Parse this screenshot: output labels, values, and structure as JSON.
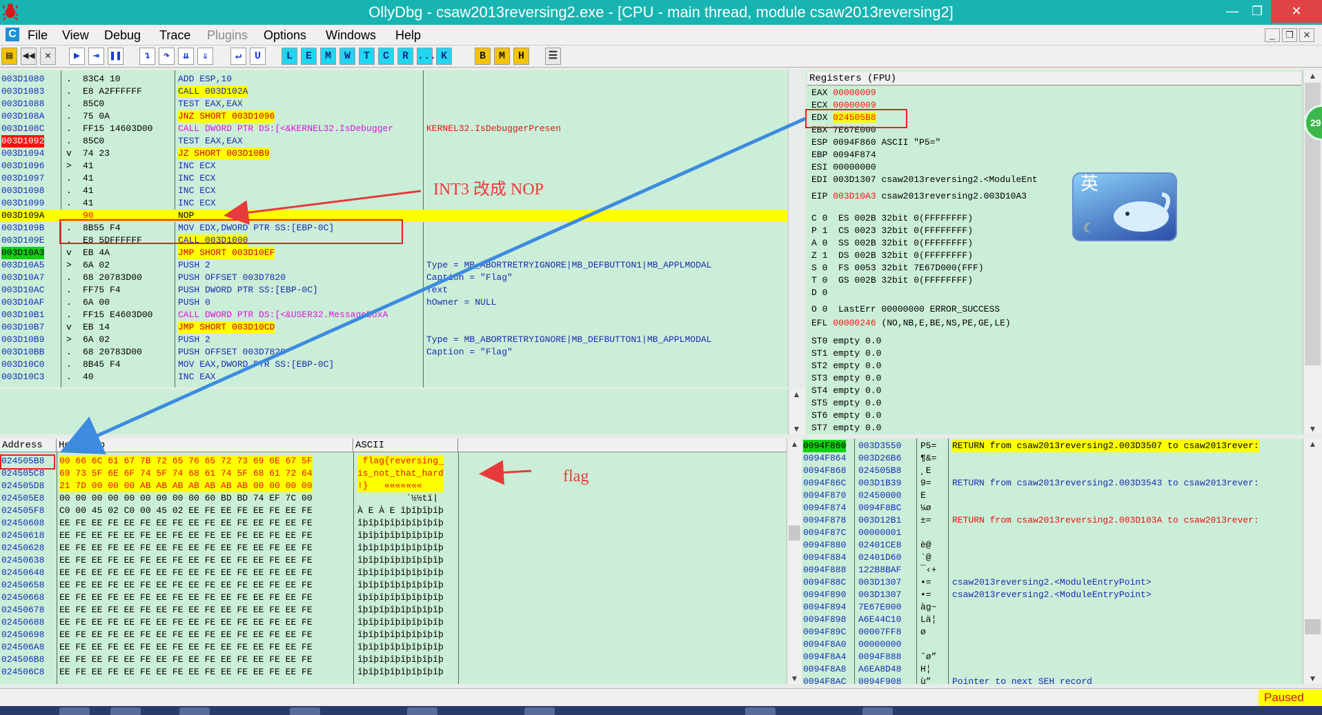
{
  "window": {
    "title": "OllyDbg - csaw2013reversing2.exe - [CPU - main thread, module csaw2013reversing2]"
  },
  "menu": {
    "app_letter": "C",
    "items": [
      "File",
      "View",
      "Debug",
      "Trace",
      "Plugins",
      "Options",
      "Windows",
      "Help"
    ],
    "disabled": [
      "Plugins"
    ]
  },
  "toolbar": {
    "letters": [
      "L",
      "E",
      "M",
      "W",
      "T",
      "C",
      "R",
      "...",
      "K",
      "B",
      "M",
      "H"
    ]
  },
  "disasm": {
    "rows": [
      {
        "addr": "003D1080",
        "mark": ".",
        "hex": "83C4 10",
        "asm": "ADD ESP,10",
        "comment": ""
      },
      {
        "addr": "003D1083",
        "mark": ".",
        "hex": "E8 A2FFFFFF",
        "asm": "CALL 003D102A",
        "comment": ""
      },
      {
        "addr": "003D1088",
        "mark": ".",
        "hex": "85C0",
        "asm": "TEST EAX,EAX",
        "comment": ""
      },
      {
        "addr": "003D108A",
        "mark": ".",
        "hex": "75 0A",
        "asm": "JNZ SHORT 003D1096",
        "comment": ""
      },
      {
        "addr": "003D108C",
        "mark": ".",
        "hex": "FF15 14603D00",
        "asm": "CALL DWORD PTR DS:[<&KERNEL32.IsDebugger",
        "comment": "KERNEL32.IsDebuggerPresen"
      },
      {
        "addr": "003D1092",
        "mark": ".",
        "hex": "85C0",
        "asm": "TEST EAX,EAX",
        "comment": ""
      },
      {
        "addr": "003D1094",
        "mark": "v",
        "hex": "74 23",
        "asm": "JZ SHORT 003D10B9",
        "comment": ""
      },
      {
        "addr": "003D1096",
        "mark": ">",
        "hex": "41",
        "asm": "INC ECX",
        "comment": ""
      },
      {
        "addr": "003D1097",
        "mark": ".",
        "hex": "41",
        "asm": "INC ECX",
        "comment": ""
      },
      {
        "addr": "003D1098",
        "mark": ".",
        "hex": "41",
        "asm": "INC ECX",
        "comment": ""
      },
      {
        "addr": "003D1099",
        "mark": ".",
        "hex": "41",
        "asm": "INC ECX",
        "comment": ""
      },
      {
        "addr": "003D109A",
        "mark": "",
        "hex": "90",
        "asm": "NOP",
        "comment": ""
      },
      {
        "addr": "003D109B",
        "mark": ".",
        "hex": "8B55 F4",
        "asm": "MOV EDX,DWORD PTR SS:[EBP-0C]",
        "comment": ""
      },
      {
        "addr": "003D109E",
        "mark": ".",
        "hex": "E8 5DFFFFFF",
        "asm": "CALL 003D1000",
        "comment": ""
      },
      {
        "addr": "003D10A3",
        "mark": "v",
        "hex": "EB 4A",
        "asm": "JMP SHORT 003D10EF",
        "comment": ""
      },
      {
        "addr": "003D10A5",
        "mark": ">",
        "hex": "6A 02",
        "asm": "PUSH 2",
        "comment": "Type = MB_ABORTRETRYIGNORE|MB_DEFBUTTON1|MB_APPLMODAL"
      },
      {
        "addr": "003D10A7",
        "mark": ".",
        "hex": "68 20783D00",
        "asm": "PUSH OFFSET 003D7820",
        "comment": "Caption = \"Flag\""
      },
      {
        "addr": "003D10AC",
        "mark": ".",
        "hex": "FF75 F4",
        "asm": "PUSH DWORD PTR SS:[EBP-0C]",
        "comment": "Text"
      },
      {
        "addr": "003D10AF",
        "mark": ".",
        "hex": "6A 00",
        "asm": "PUSH 0",
        "comment": "hOwner = NULL"
      },
      {
        "addr": "003D10B1",
        "mark": ".",
        "hex": "FF15 E4603D00",
        "asm": "CALL DWORD PTR DS:[<&USER32.MessageBoxA",
        "comment": ""
      },
      {
        "addr": "003D10B7",
        "mark": "v",
        "hex": "EB 14",
        "asm": "JMP SHORT 003D10CD",
        "comment": ""
      },
      {
        "addr": "003D10B9",
        "mark": ">",
        "hex": "6A 02",
        "asm": "PUSH 2",
        "comment": "Type = MB_ABORTRETRYIGNORE|MB_DEFBUTTON1|MB_APPLMODAL"
      },
      {
        "addr": "003D10BB",
        "mark": ".",
        "hex": "68 20783D00",
        "asm": "PUSH OFFSET 003D7820",
        "comment": "Caption = \"Flag\""
      },
      {
        "addr": "003D10C0",
        "mark": ".",
        "hex": "8B45 F4",
        "asm": "MOV EAX,DWORD PTR SS:[EBP-0C]",
        "comment": ""
      },
      {
        "addr": "003D10C3",
        "mark": ".",
        "hex": "40",
        "asm": "INC EAX",
        "comment": ""
      }
    ]
  },
  "registers": {
    "header": "Registers (FPU)",
    "lines": [
      {
        "name": "EAX",
        "val": "00000009",
        "extra": ""
      },
      {
        "name": "ECX",
        "val": "00000009",
        "extra": ""
      },
      {
        "name": "EDX",
        "val": "024505B8",
        "extra": ""
      },
      {
        "name": "EBX",
        "val": "7E67E000",
        "extra": ""
      },
      {
        "name": "ESP",
        "val": "0094F860",
        "extra": "ASCII \"P5=\""
      },
      {
        "name": "EBP",
        "val": "0094F874",
        "extra": ""
      },
      {
        "name": "ESI",
        "val": "00000000",
        "extra": ""
      },
      {
        "name": "EDI",
        "val": "003D1307",
        "extra": "csaw2013reversing2.<ModuleEnt"
      },
      {
        "name": "EIP",
        "val": "003D10A3",
        "extra": "csaw2013reversing2.003D10A3"
      }
    ],
    "flags": [
      "C 0  ES 002B 32bit 0(FFFFFFFF)",
      "P 1  CS 0023 32bit 0(FFFFFFFF)",
      "A 0  SS 002B 32bit 0(FFFFFFFF)",
      "Z 1  DS 002B 32bit 0(FFFFFFFF)",
      "S 0  FS 0053 32bit 7E67D000(FFF)",
      "T 0  GS 002B 32bit 0(FFFFFFFF)",
      "D 0",
      "O 0  LastErr 00000000 ERROR_SUCCESS"
    ],
    "efl": "EFL",
    "efl_val": "00000246",
    "efl_flags": "(NO,NB,E,BE,NS,PE,GE,LE)",
    "fpu": [
      "ST0 empty 0.0",
      "ST1 empty 0.0",
      "ST2 empty 0.0",
      "ST3 empty 0.0",
      "ST4 empty 0.0",
      "ST5 empty 0.0",
      "ST6 empty 0.0",
      "ST7 empty 0.0"
    ],
    "ime_char": "英",
    "side_badge": "29"
  },
  "dump": {
    "headers": {
      "address": "Address",
      "hex": "Hex dump",
      "ascii": "ASCII"
    },
    "rows": [
      {
        "addr": "024505B8",
        "hex": "00 66 6C 61 67 7B 72 65 76 65 72 73 69 6E 67 5F",
        "ascii": " flag{reversing_"
      },
      {
        "addr": "024505C8",
        "hex": "69 73 5F 6E 6F 74 5F 74 68 61 74 5F 68 61 72 64",
        "ascii": "is_not_that_hard"
      },
      {
        "addr": "024505D8",
        "hex": "21 7D 00 00 00 AB AB AB AB AB AB AB 00 00 00 00",
        "ascii": "!}   «««««««    "
      },
      {
        "addr": "024505E8",
        "hex": "00 00 00 00 00 00 00 00 00 60 BD BD 74 EF 7C 00",
        "ascii": "         `½½tï| "
      },
      {
        "addr": "024505F8",
        "hex": "C0 00 45 02 C0 00 45 02 EE FE EE FE EE FE EE FE",
        "ascii": "À E À E îþîþîþîþ"
      },
      {
        "addr": "02450608",
        "hex": "EE FE EE FE EE FE EE FE EE FE EE FE EE FE EE FE",
        "ascii": "îþîþîþîþîþîþîþîþ"
      },
      {
        "addr": "02450618",
        "hex": "EE FE EE FE EE FE EE FE EE FE EE FE EE FE EE FE",
        "ascii": "îþîþîþîþîþîþîþîþ"
      },
      {
        "addr": "02450628",
        "hex": "EE FE EE FE EE FE EE FE EE FE EE FE EE FE EE FE",
        "ascii": "îþîþîþîþîþîþîþîþ"
      },
      {
        "addr": "02450638",
        "hex": "EE FE EE FE EE FE EE FE EE FE EE FE EE FE EE FE",
        "ascii": "îþîþîþîþîþîþîþîþ"
      },
      {
        "addr": "02450648",
        "hex": "EE FE EE FE EE FE EE FE EE FE EE FE EE FE EE FE",
        "ascii": "îþîþîþîþîþîþîþîþ"
      },
      {
        "addr": "02450658",
        "hex": "EE FE EE FE EE FE EE FE EE FE EE FE EE FE EE FE",
        "ascii": "îþîþîþîþîþîþîþîþ"
      },
      {
        "addr": "02450668",
        "hex": "EE FE EE FE EE FE EE FE EE FE EE FE EE FE EE FE",
        "ascii": "îþîþîþîþîþîþîþîþ"
      },
      {
        "addr": "02450678",
        "hex": "EE FE EE FE EE FE EE FE EE FE EE FE EE FE EE FE",
        "ascii": "îþîþîþîþîþîþîþîþ"
      },
      {
        "addr": "02450688",
        "hex": "EE FE EE FE EE FE EE FE EE FE EE FE EE FE EE FE",
        "ascii": "îþîþîþîþîþîþîþîþ"
      },
      {
        "addr": "02450698",
        "hex": "EE FE EE FE EE FE EE FE EE FE EE FE EE FE EE FE",
        "ascii": "îþîþîþîþîþîþîþîþ"
      },
      {
        "addr": "024506A8",
        "hex": "EE FE EE FE EE FE EE FE EE FE EE FE EE FE EE FE",
        "ascii": "îþîþîþîþîþîþîþîþ"
      },
      {
        "addr": "024506B8",
        "hex": "EE FE EE FE EE FE EE FE EE FE EE FE EE FE EE FE",
        "ascii": "îþîþîþîþîþîþîþîþ"
      },
      {
        "addr": "024506C8",
        "hex": "EE FE EE FE EE FE EE FE EE FE EE FE EE FE EE FE",
        "ascii": "îþîþîþîþîþîþîþîþ"
      }
    ]
  },
  "stack": {
    "rows": [
      {
        "addr": "0094F860",
        "val": "003D3550",
        "asc": "P5=",
        "comment": "RETURN from csaw2013reversing2.003D3507 to csaw2013rever:"
      },
      {
        "addr": "0094F864",
        "val": "003D26B6",
        "asc": "¶&=",
        "comment": ""
      },
      {
        "addr": "0094F868",
        "val": "024505B8",
        "asc": "¸E",
        "comment": ""
      },
      {
        "addr": "0094F86C",
        "val": "003D1B39",
        "asc": "9=",
        "comment": "RETURN from csaw2013reversing2.003D3543 to csaw2013rever:"
      },
      {
        "addr": "0094F870",
        "val": "02450000",
        "asc": "E",
        "comment": ""
      },
      {
        "addr": "0094F874",
        "val": "0094F8BC",
        "asc": "¼ø",
        "comment": ""
      },
      {
        "addr": "0094F878",
        "val": "003D12B1",
        "asc": "±=",
        "comment": "RETURN from csaw2013reversing2.003D103A to csaw2013rever:"
      },
      {
        "addr": "0094F87C",
        "val": "00000001",
        "asc": "",
        "comment": ""
      },
      {
        "addr": "0094F880",
        "val": "02401CE8",
        "asc": "è@",
        "comment": ""
      },
      {
        "addr": "0094F884",
        "val": "02401D60",
        "asc": "`@",
        "comment": ""
      },
      {
        "addr": "0094F888",
        "val": "122B8BAF",
        "asc": "¯‹+",
        "comment": ""
      },
      {
        "addr": "0094F88C",
        "val": "003D1307",
        "asc": "•=",
        "comment": "csaw2013reversing2.<ModuleEntryPoint>"
      },
      {
        "addr": "0094F890",
        "val": "003D1307",
        "asc": "•=",
        "comment": "csaw2013reversing2.<ModuleEntryPoint>"
      },
      {
        "addr": "0094F894",
        "val": "7E67E000",
        "asc": "àg~",
        "comment": ""
      },
      {
        "addr": "0094F898",
        "val": "A6E44C10",
        "asc": "Lä¦",
        "comment": ""
      },
      {
        "addr": "0094F89C",
        "val": "00007FF8",
        "asc": "ø",
        "comment": ""
      },
      {
        "addr": "0094F8A0",
        "val": "00000000",
        "asc": "",
        "comment": ""
      },
      {
        "addr": "0094F8A4",
        "val": "0094F888",
        "asc": "ˆø”",
        "comment": ""
      },
      {
        "addr": "0094F8A8",
        "val": "A6EA8D48",
        "asc": "H¦",
        "comment": ""
      },
      {
        "addr": "0094F8AC",
        "val": "0094F908",
        "asc": "ù”",
        "comment": "Pointer to next SEH record"
      }
    ]
  },
  "annotations": {
    "int3": "INT3 改成 NOP",
    "flag": "flag"
  },
  "status": {
    "paused": "Paused"
  },
  "colors": {
    "title_bar": "#18b4b2",
    "pane_bg": "#cbeed8",
    "highlight": "#ffff00",
    "eip_green": "#10d010",
    "breakpoint_red": "#ff1010",
    "annotation_red": "#e83a3a",
    "arrow_blue": "#3d8be0"
  }
}
